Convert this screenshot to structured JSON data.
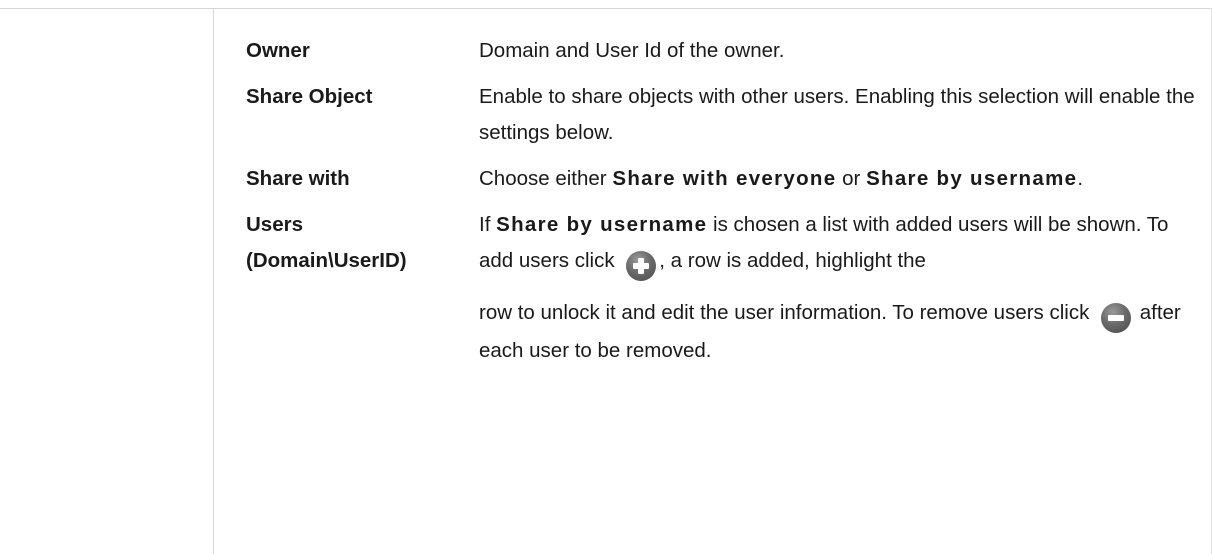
{
  "rows": [
    {
      "term": "Owner",
      "desc": "Domain and User Id of the owner."
    },
    {
      "term": "Share Object",
      "desc": "Enable to share objects with other users. Enabling this selection will enable the settings below."
    },
    {
      "term": "Share with",
      "desc_parts": [
        "Choose either ",
        "Share with everyone",
        " or ",
        "Share by username",
        "."
      ]
    },
    {
      "term_lines": [
        "Users",
        "(Domain\\UserID)"
      ],
      "desc_parts": [
        "If ",
        "Share by username",
        " is chosen a list with added users will be shown. To add users click ",
        ", a row is added, highlight the",
        "row to unlock it and edit the user information. To remove users click ",
        " after each user to be removed."
      ]
    }
  ],
  "icons": {
    "add": "add-circle-icon",
    "remove": "remove-circle-icon"
  }
}
